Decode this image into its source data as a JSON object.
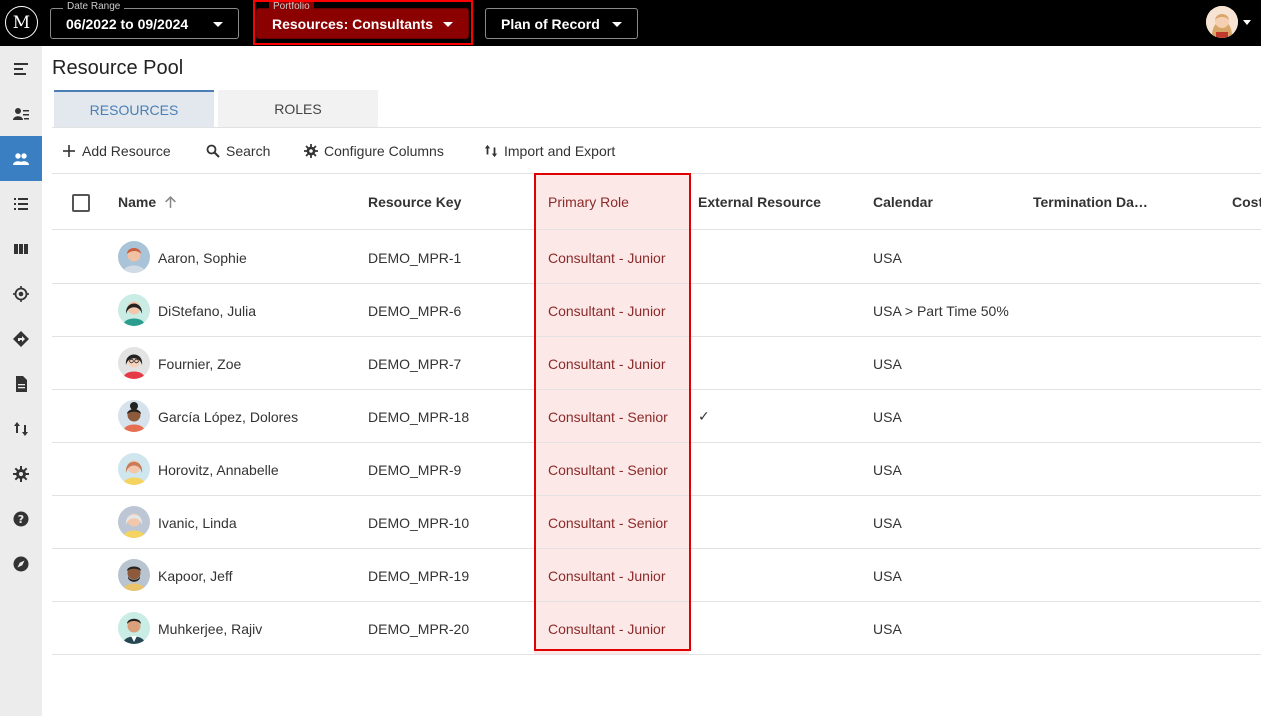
{
  "topbar": {
    "logo": "M",
    "date_range": {
      "label": "Date Range",
      "value": "06/2022 to 09/2024"
    },
    "portfolio": {
      "label": "Portfolio",
      "value": "Resources: Consultants"
    },
    "plan": {
      "value": "Plan of Record"
    },
    "accent_color": "#8b0000"
  },
  "sidebar": {
    "items": [
      {
        "icon": "menu-icon"
      },
      {
        "icon": "user-list-icon"
      },
      {
        "icon": "people-icon",
        "active": true
      },
      {
        "icon": "list-icon"
      },
      {
        "icon": "columns-icon"
      },
      {
        "icon": "target-icon"
      },
      {
        "icon": "directions-icon"
      },
      {
        "icon": "document-icon"
      },
      {
        "icon": "import-export-icon"
      },
      {
        "icon": "gear-icon"
      },
      {
        "icon": "help-icon"
      },
      {
        "icon": "compass-icon"
      }
    ],
    "active_color": "#3a7fc1"
  },
  "page": {
    "title": "Resource Pool"
  },
  "tabs": [
    {
      "label": "RESOURCES",
      "active": true
    },
    {
      "label": "ROLES",
      "active": false
    }
  ],
  "toolbar": {
    "add": "Add Resource",
    "search": "Search",
    "configure": "Configure Columns",
    "import_export": "Import and Export"
  },
  "table": {
    "columns": [
      "Name",
      "Resource Key",
      "Primary Role",
      "External Resource",
      "Calendar",
      "Termination Da…",
      "Cost"
    ],
    "rows": [
      {
        "name": "Aaron, Sophie",
        "key": "DEMO_MPR-1",
        "role": "Consultant - Junior",
        "external": "",
        "calendar": "USA"
      },
      {
        "name": "DiStefano, Julia",
        "key": "DEMO_MPR-6",
        "role": "Consultant - Junior",
        "external": "",
        "calendar": "USA > Part Time 50%"
      },
      {
        "name": "Fournier, Zoe",
        "key": "DEMO_MPR-7",
        "role": "Consultant - Junior",
        "external": "",
        "calendar": "USA"
      },
      {
        "name": "García López, Dolores",
        "key": "DEMO_MPR-18",
        "role": "Consultant - Senior",
        "external": "✓",
        "calendar": "USA"
      },
      {
        "name": "Horovitz, Annabelle",
        "key": "DEMO_MPR-9",
        "role": "Consultant - Senior",
        "external": "",
        "calendar": "USA"
      },
      {
        "name": "Ivanic, Linda",
        "key": "DEMO_MPR-10",
        "role": "Consultant - Senior",
        "external": "",
        "calendar": "USA"
      },
      {
        "name": "Kapoor, Jeff",
        "key": "DEMO_MPR-19",
        "role": "Consultant - Junior",
        "external": "",
        "calendar": "USA"
      },
      {
        "name": "Muhkerjee, Rajiv",
        "key": "DEMO_MPR-20",
        "role": "Consultant - Junior",
        "external": "",
        "calendar": "USA"
      }
    ],
    "highlight_color": "#e00000"
  }
}
